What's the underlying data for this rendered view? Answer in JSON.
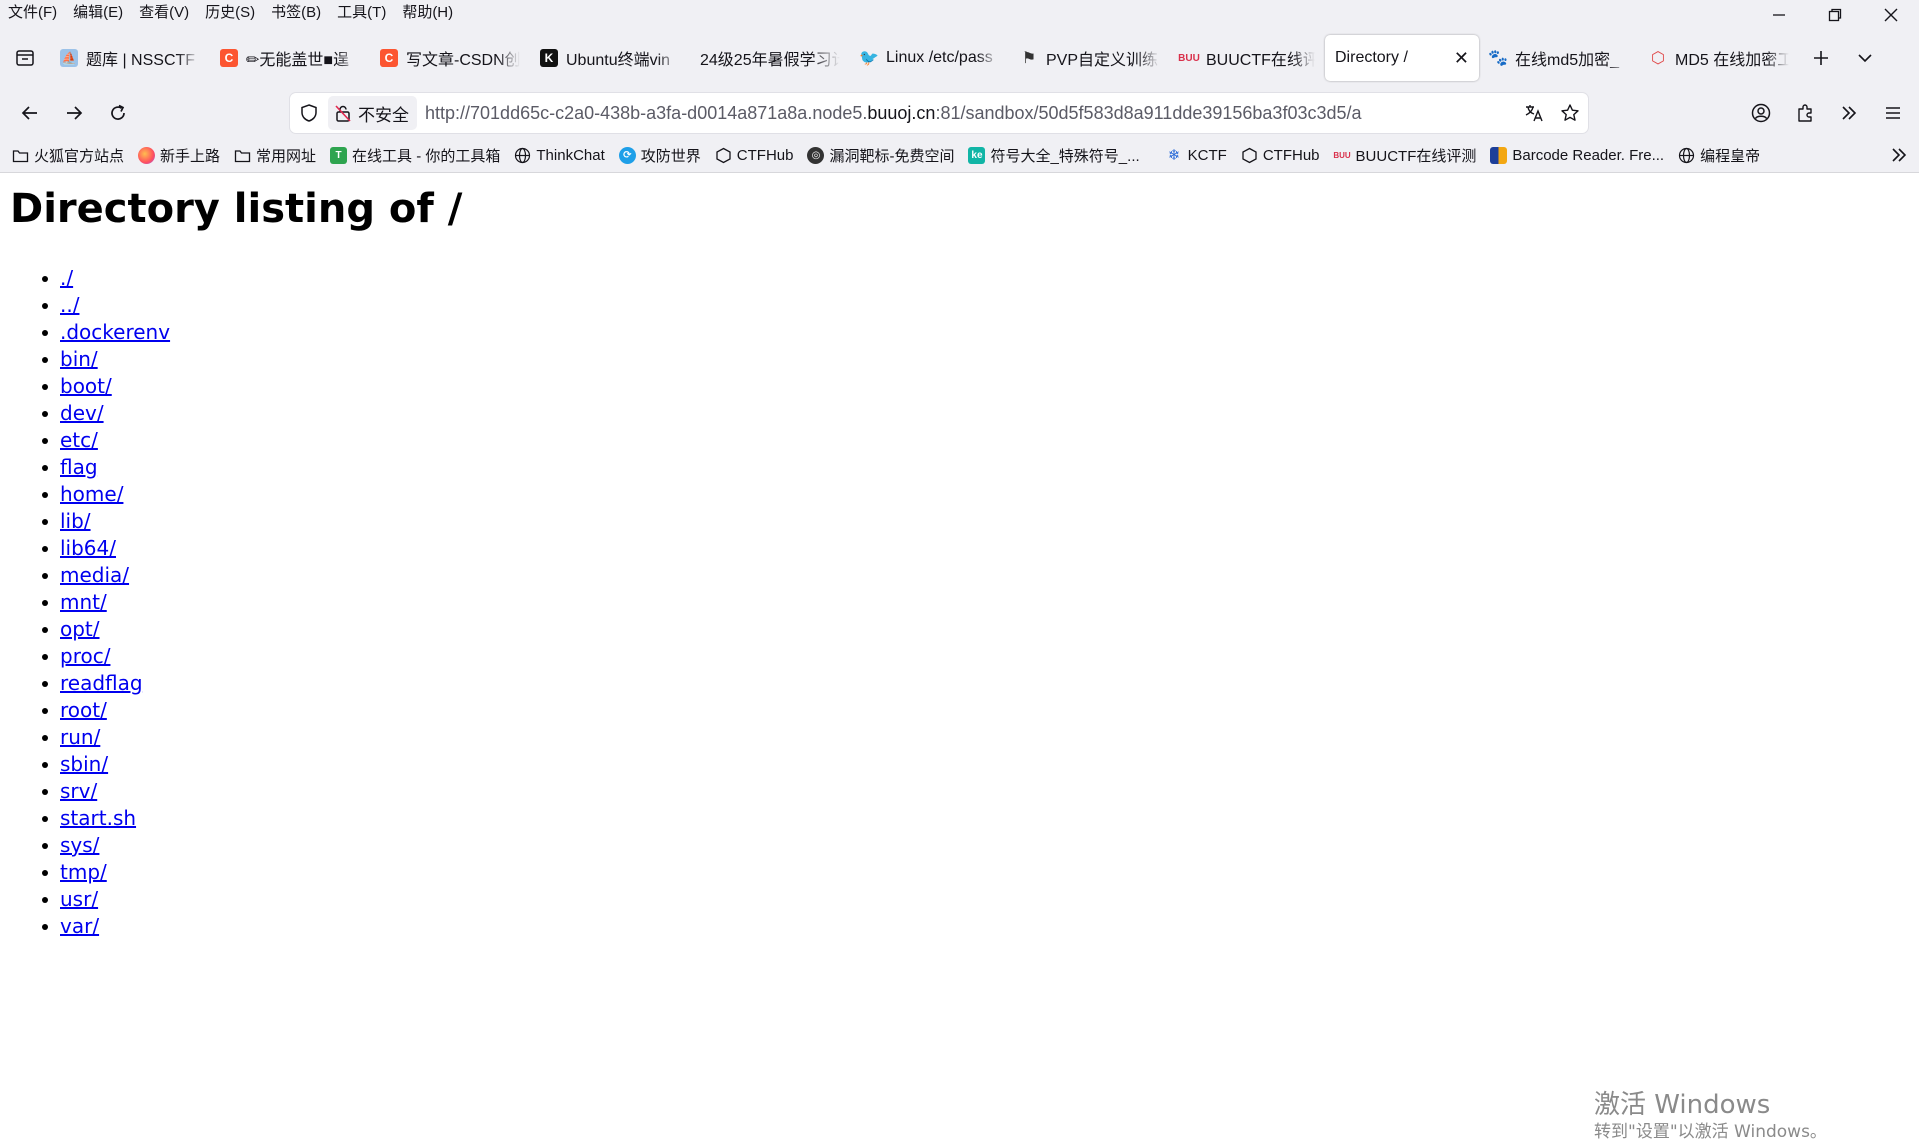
{
  "menubar": {
    "items": [
      "文件(F)",
      "编辑(E)",
      "查看(V)",
      "历史(S)",
      "书签(B)",
      "工具(T)",
      "帮助(H)"
    ]
  },
  "tabs": [
    {
      "title": "题库 | NSSCTF",
      "icon": "nssctf-icon",
      "color": "#4a90d9"
    },
    {
      "title": "✏无能盖世■逞",
      "icon": "csdn-icon",
      "color": "#fc5531"
    },
    {
      "title": "写文章-CSDN创",
      "icon": "csdn-icon",
      "color": "#fc5531"
    },
    {
      "title": "Ubuntu终端vin",
      "icon": "k-icon",
      "color": "#111111"
    },
    {
      "title": "24级25年暑假学习计",
      "icon": "",
      "color": ""
    },
    {
      "title": "Linux /etc/pass",
      "icon": "bird-icon",
      "color": "#3b6fd8"
    },
    {
      "title": "PVP自定义训练",
      "icon": "flag-icon",
      "color": "#333333"
    },
    {
      "title": "BUUCTF在线评",
      "icon": "buu-icon",
      "color": "#d9304b"
    },
    {
      "title": "Directory /",
      "icon": "",
      "color": "",
      "active": true
    },
    {
      "title": "在线md5加密_",
      "icon": "paw-icon",
      "color": "#2f54eb"
    },
    {
      "title": "MD5 在线加密工",
      "icon": "cube-icon",
      "color": "#e04a4a"
    }
  ],
  "nav": {
    "insecure_label": "不安全",
    "url_prefix": "http://701dd65c-c2a0-438b-a3fa-d0014a871a8a.node5.",
    "url_host": "buuoj.cn",
    "url_suffix": ":81/sandbox/50d5f583d8a911dde39156ba3f03c3d5/a"
  },
  "bookmarks": [
    {
      "label": "火狐官方站点",
      "icon": "folder-icon"
    },
    {
      "label": "新手上路",
      "icon": "firefox-icon"
    },
    {
      "label": "常用网址",
      "icon": "folder-icon"
    },
    {
      "label": "在线工具 - 你的工具箱",
      "icon": "tool-icon"
    },
    {
      "label": "ThinkChat",
      "icon": "globe-icon"
    },
    {
      "label": "攻防世界",
      "icon": "adworld-icon"
    },
    {
      "label": "CTFHub",
      "icon": "hex-icon"
    },
    {
      "label": "漏洞靶标-免费空间",
      "icon": "bug-icon"
    },
    {
      "label": "符号大全_特殊符号_...",
      "icon": "ke-icon"
    },
    {
      "label": "KCTF",
      "icon": "snow-icon"
    },
    {
      "label": "CTFHub",
      "icon": "hex-icon"
    },
    {
      "label": "BUUCTF在线评测",
      "icon": "buu-icon"
    },
    {
      "label": "Barcode Reader. Fre...",
      "icon": "barcode-icon"
    },
    {
      "label": "编程皇帝",
      "icon": "globe-icon"
    }
  ],
  "page": {
    "heading": "Directory listing of /",
    "entries": [
      "./",
      "../",
      ".dockerenv",
      "bin/",
      "boot/",
      "dev/",
      "etc/",
      "flag",
      "home/",
      "lib/",
      "lib64/",
      "media/",
      "mnt/",
      "opt/",
      "proc/",
      "readflag",
      "root/",
      "run/",
      "sbin/",
      "srv/",
      "start.sh",
      "sys/",
      "tmp/",
      "usr/",
      "var/"
    ]
  },
  "watermark": {
    "line1": "激活 Windows",
    "line2": "转到\"设置\"以激活 Windows。"
  }
}
